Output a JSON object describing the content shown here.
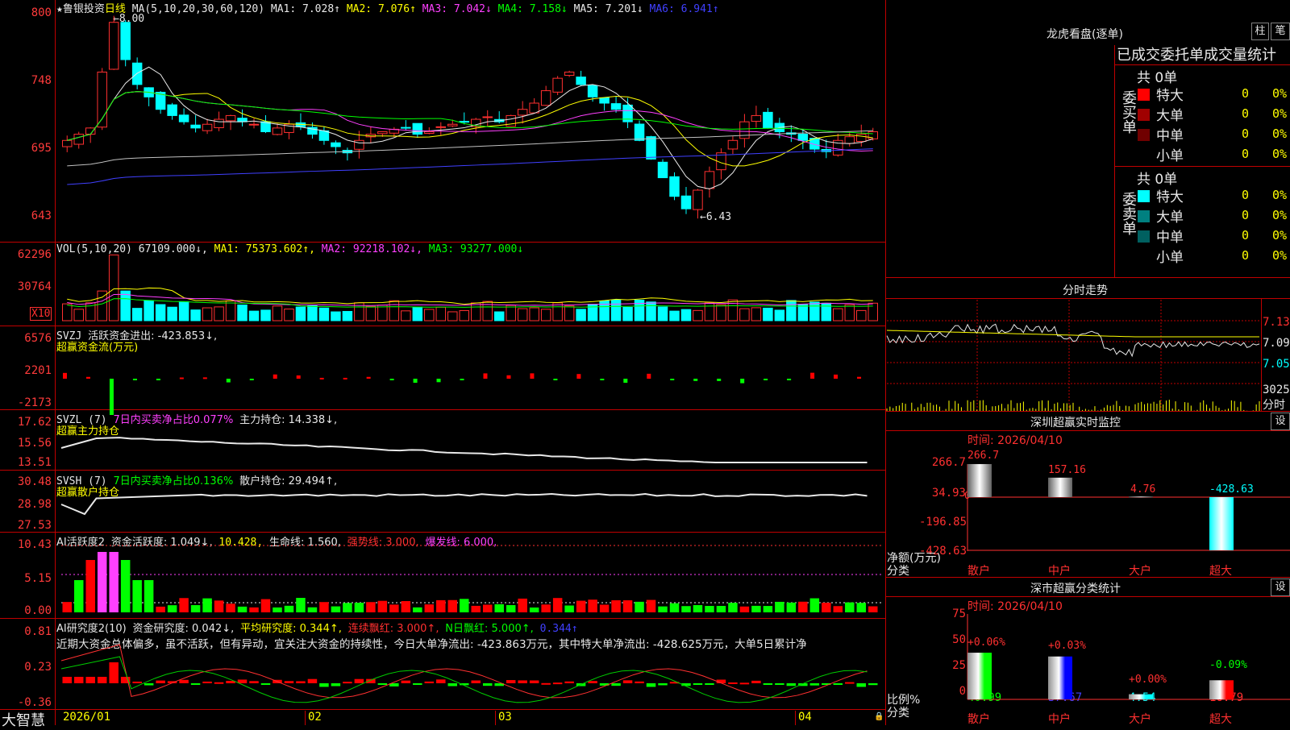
{
  "main": {
    "title_star": "★",
    "stock_name": "鲁银投资",
    "period": "日线",
    "ma_label": "MA(5,10,20,30,60,120)",
    "ma": [
      {
        "text": "MA1: 7.028↑",
        "color": "#e8e8e8"
      },
      {
        "text": "MA2: 7.076↑",
        "color": "#ffff00"
      },
      {
        "text": "MA3: 7.042↓",
        "color": "#ff40ff"
      },
      {
        "text": "MA4: 7.158↓",
        "color": "#00ff00"
      },
      {
        "text": "MA5: 7.201↓",
        "color": "#e8e8e8"
      },
      {
        "text": "MA6: 6.941↑",
        "color": "#4040ff"
      }
    ],
    "price_axis": [
      "800",
      "748",
      "695",
      "643"
    ],
    "high_mark": "8.00",
    "low_mark": "←6.43"
  },
  "vol": {
    "label": "VOL(5,10,20)",
    "value": "67109.000↓,",
    "ma1": "MA1: 75373.602↑,",
    "ma2": "MA2: 92218.102↓,",
    "ma3": "MA3: 93277.000↓",
    "axis": [
      "62296",
      "30764"
    ],
    "unit": "X10"
  },
  "svzj": {
    "label": "SVZJ",
    "value": "活跃资金进出: -423.853↓,",
    "subtitle": "超赢资金流(万元)",
    "axis": [
      "6576",
      "2201",
      "-2173"
    ]
  },
  "svzl": {
    "label": "SVZL (7)",
    "note": "7日内买卖净占比0.077%",
    "value": "主力持仓: 14.338↓,",
    "subtitle": "超赢主力持仓",
    "axis": [
      "17.62",
      "15.56",
      "13.51"
    ]
  },
  "svsh": {
    "label": "SVSH (7)",
    "note": "7日内买卖净占比0.136%",
    "value": "散户持仓: 29.494↑,",
    "subtitle": "超赢散户持仓",
    "axis": [
      "30.48",
      "28.98",
      "27.53"
    ]
  },
  "ai1": {
    "label": "AI活跃度2",
    "value": "资金活跃度: 1.049↓,",
    "v2": "10.428,",
    "life": "生命线: 1.560,",
    "strong": "强势线: 3.000,",
    "burst": "爆发线: 6.000,",
    "axis": [
      "10.43",
      "5.15",
      "0.00"
    ]
  },
  "ai2": {
    "label": "AI研究度2(10)",
    "value": "资金研究度: 0.042↓,",
    "avg": "平均研究度: 0.344↑,",
    "red": "连续飘红: 3.000↑,",
    "nred": "N日飘红: 5.000↑,",
    "last": "0.344↑",
    "comment": "近期大资金总体偏多，虽不活跃，但有异动，宜关注大资金的持续性，今日大单净流出: -423.863万元，其中特大单净流出: -428.625万元，大单5日累计净",
    "axis": [
      "0.81",
      "0.23",
      "-0.36"
    ]
  },
  "dates": [
    "2026/01",
    "02",
    "03",
    "04"
  ],
  "brand": "大智慧",
  "dragon": {
    "title": "龙虎看盘(逐单)",
    "btn1": "柱",
    "btn2": "笔",
    "header": "已成交委托单成交量统计",
    "buy_label": "委买单",
    "sell_label": "委卖单",
    "buy_total": "共 0单",
    "sell_total": "共 0单",
    "buy_rows": [
      {
        "name": "特大",
        "count": "0",
        "pct": "0%",
        "color": "#ff0000"
      },
      {
        "name": "大单",
        "count": "0",
        "pct": "0%",
        "color": "#a00000"
      },
      {
        "name": "中单",
        "count": "0",
        "pct": "0%",
        "color": "#700000"
      },
      {
        "name": "小单",
        "count": "0",
        "pct": "0%",
        "color": "#000000"
      }
    ],
    "sell_rows": [
      {
        "name": "特大",
        "count": "0",
        "pct": "0%",
        "color": "#00ffff"
      },
      {
        "name": "大单",
        "count": "0",
        "pct": "0%",
        "color": "#008080"
      },
      {
        "name": "中单",
        "count": "0",
        "pct": "0%",
        "color": "#006060"
      },
      {
        "name": "小单",
        "count": "0",
        "pct": "0%",
        "color": "#000000"
      }
    ]
  },
  "intraday": {
    "title": "分时走势",
    "axis": [
      "7.13",
      "7.09",
      "7.05",
      "3025"
    ],
    "unit": "分时"
  },
  "monitor": {
    "title": "深圳超赢实时监控",
    "set": "设",
    "time": "时间: 2026/04/10",
    "axis": [
      "266.7",
      "34.93",
      "-196.85",
      "-428.63"
    ],
    "axis_zero": "0",
    "ylabel": "净额(万元)",
    "xlabel": "分类",
    "categories": [
      "散户",
      "中户",
      "大户",
      "超大"
    ],
    "values": [
      "266.7",
      "157.16",
      "4.76",
      "-428.63"
    ]
  },
  "classify": {
    "title": "深市超赢分类统计",
    "set": "设",
    "time": "时间: 2026/04/10",
    "axis": [
      "75",
      "50",
      "25",
      "0"
    ],
    "ylabel": "比例%",
    "xlabel": "分类",
    "categories": [
      "散户",
      "中户",
      "大户",
      "超大"
    ],
    "changes": [
      "+0.06%",
      "+0.03%",
      "+0.00%",
      "-0.09%"
    ],
    "values": [
      "40.99",
      "37.67",
      "4.54",
      "16.79"
    ]
  },
  "chart_data": {
    "type": "bar",
    "title": "深圳超赢实时监控",
    "categories": [
      "散户",
      "中户",
      "大户",
      "超大"
    ],
    "values": [
      266.7,
      157.16,
      4.76,
      -428.63
    ],
    "ylabel": "净额(万元)",
    "ylim": [
      -428.63,
      266.7
    ],
    "classification": {
      "categories": [
        "散户",
        "中户",
        "大户",
        "超大"
      ],
      "values": [
        40.99,
        37.67,
        4.54,
        16.79
      ],
      "ylim": [
        0,
        75
      ]
    }
  }
}
